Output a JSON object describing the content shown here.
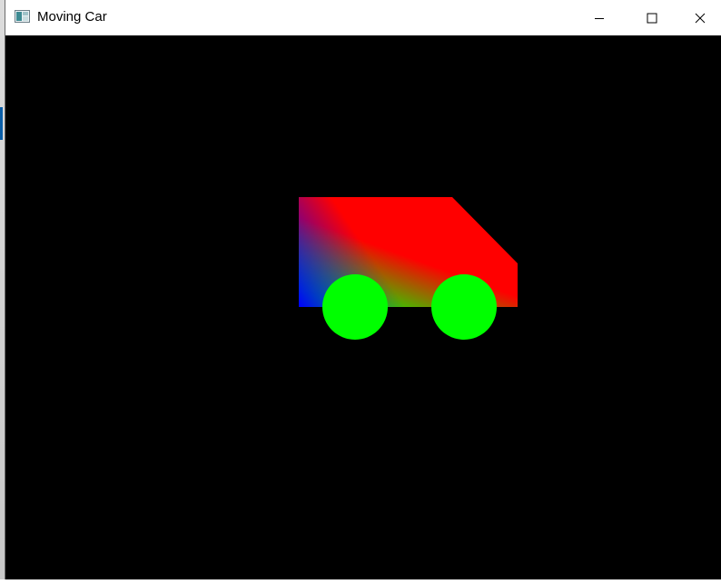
{
  "window": {
    "title": "Moving Car",
    "icon": "app-window-icon",
    "controls": {
      "minimize_icon": "minimize-icon",
      "maximize_icon": "maximize-icon",
      "close_icon": "close-icon"
    }
  },
  "scene": {
    "background_color": "#000000",
    "car_body": {
      "gradient_colors": [
        "#ff0000",
        "#00ff00",
        "#0000ff"
      ]
    },
    "wheel_color": "#00ff00"
  }
}
